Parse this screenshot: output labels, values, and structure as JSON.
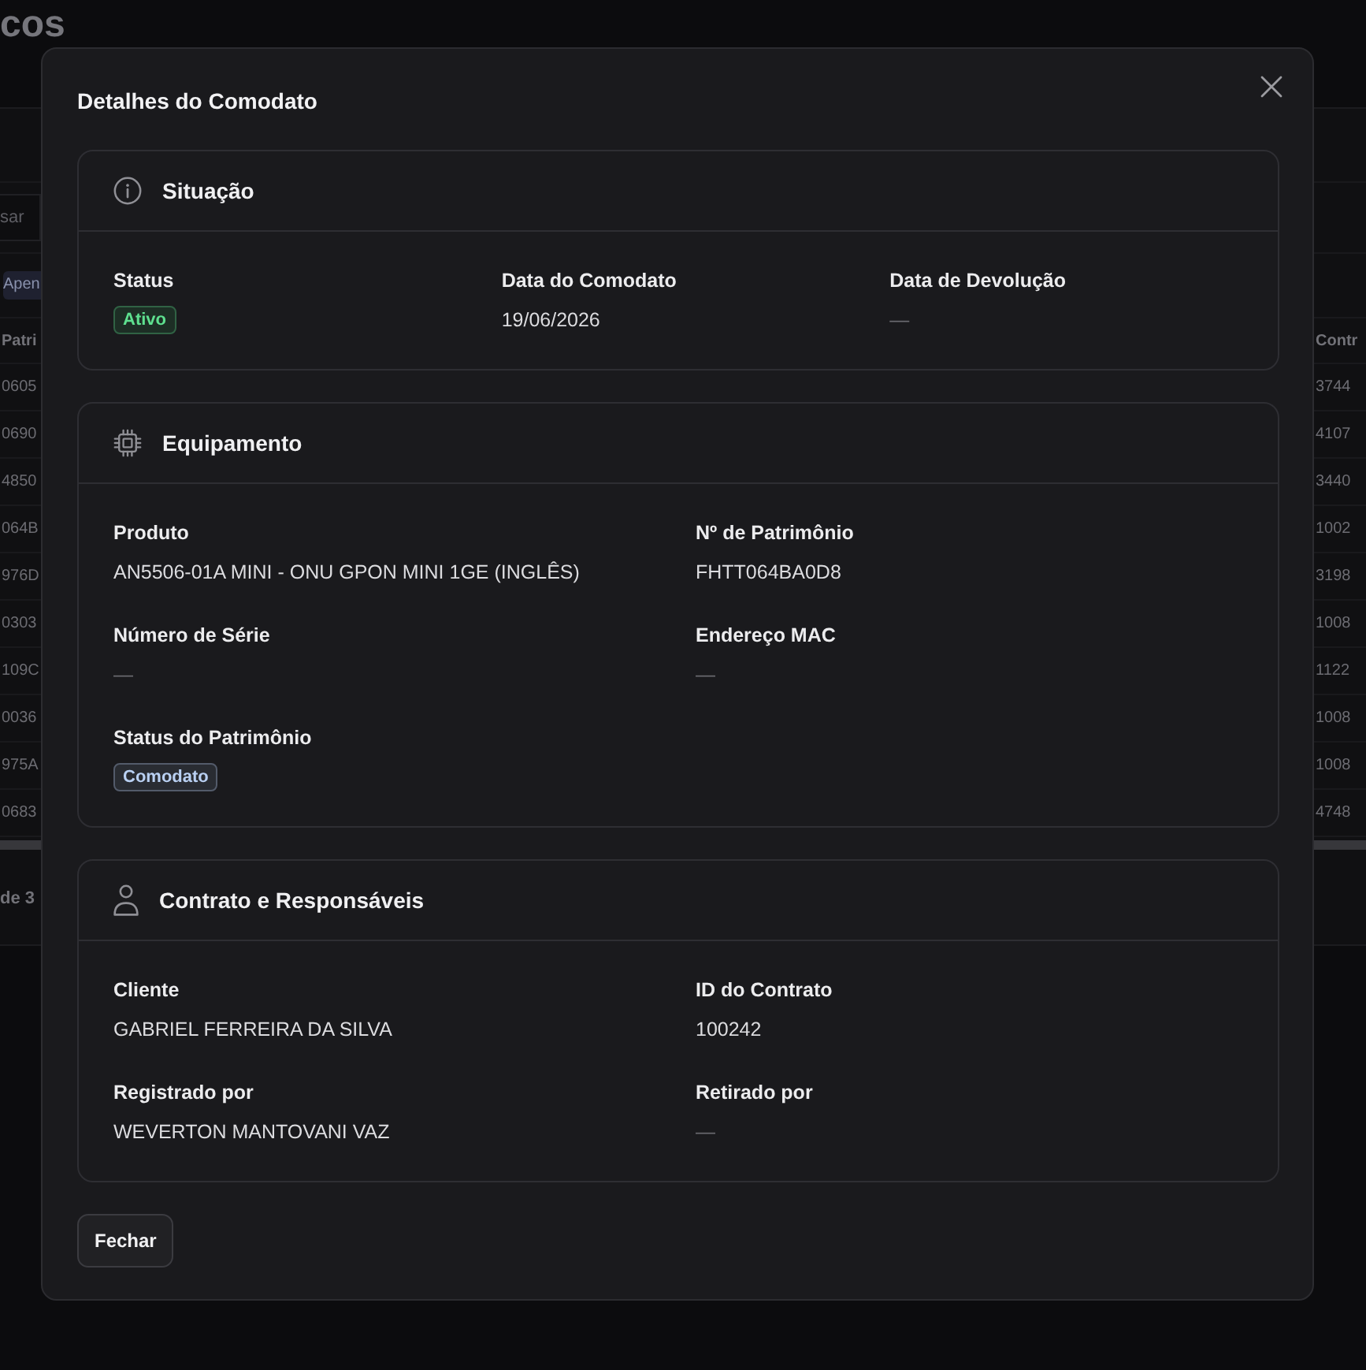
{
  "background_page": {
    "heading": "cos",
    "search": {
      "placeholder": "sar"
    },
    "filter_chip": "Apen",
    "table": {
      "columns": [
        "Patri",
        "Contr"
      ],
      "rows": [
        [
          "0605",
          "3744"
        ],
        [
          "0690",
          "4107"
        ],
        [
          "4850",
          "3440"
        ],
        [
          "064B",
          "1002"
        ],
        [
          "976D",
          "3198"
        ],
        [
          "0303",
          "1008"
        ],
        [
          "109C",
          "1122"
        ],
        [
          "0036",
          "1008"
        ],
        [
          "975A",
          "1008"
        ],
        [
          "0683",
          "4748"
        ]
      ]
    },
    "pagination": "de 3"
  },
  "dialog": {
    "title": "Detalhes do Comodato",
    "sections": [
      {
        "title": "Situação",
        "rows": [
          [
            {
              "label": "Status",
              "value": "Ativo",
              "kind": "badge",
              "color": "#5ee08f"
            },
            {
              "label": "Data do Comodato",
              "value": "19/06/2026",
              "kind": "text"
            },
            {
              "label": "Data de Devolução",
              "value": "—",
              "kind": "blank"
            }
          ]
        ]
      },
      {
        "title": "Equipamento",
        "rows": [
          [
            {
              "label": "Produto",
              "value": "AN5506-01A MINI - ONU GPON MINI 1GE (INGLÊS)",
              "kind": "text"
            },
            {
              "label": "Nº de Patrimônio",
              "value": "FHTT064BA0D8",
              "kind": "text"
            }
          ],
          [
            {
              "label": "Número de Série",
              "value": "—",
              "kind": "blank"
            },
            {
              "label": "Endereço MAC",
              "value": "—",
              "kind": "blank"
            }
          ],
          [
            {
              "label": "Status do Patrimônio",
              "value": "Comodato",
              "kind": "badge",
              "color": "#b9d0f2"
            }
          ]
        ]
      },
      {
        "title": "Contrato e Responsáveis",
        "rows": [
          [
            {
              "label": "Cliente",
              "value": "GABRIEL FERREIRA DA SILVA",
              "kind": "text"
            },
            {
              "label": "ID do Contrato",
              "value": "100242",
              "kind": "text"
            }
          ],
          [
            {
              "label": "Registrado por",
              "value": "WEVERTON MANTOVANI VAZ",
              "kind": "text"
            },
            {
              "label": "Retirado por",
              "value": "—",
              "kind": "blank"
            }
          ]
        ]
      }
    ],
    "buttons": [
      "Fechar"
    ]
  }
}
